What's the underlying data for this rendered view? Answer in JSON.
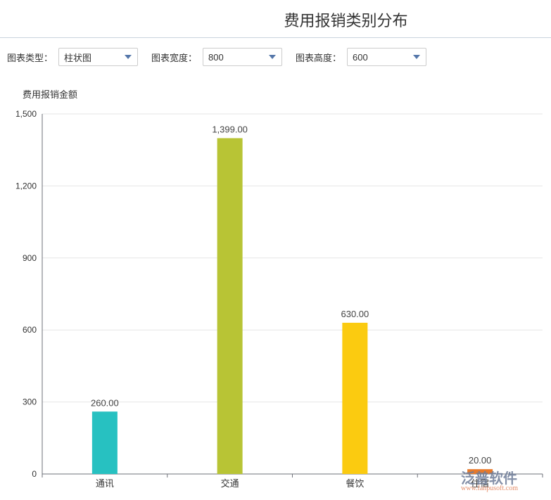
{
  "title": "费用报销类别分布",
  "controls": [
    {
      "label": "图表类型：",
      "value": "柱状图"
    },
    {
      "label": "图表宽度：",
      "value": "800"
    },
    {
      "label": "图表高度：",
      "value": "600"
    }
  ],
  "watermark": {
    "name": "泛普软件",
    "url": "www.fanpusoft.com"
  },
  "chart_data": {
    "type": "bar",
    "title": "费用报销类别分布",
    "ylabel": "费用报销金额",
    "xlabel": "",
    "categories": [
      "通讯",
      "交通",
      "餐饮",
      "住宿"
    ],
    "values": [
      260,
      1399,
      630,
      20
    ],
    "data_labels": [
      "260.00",
      "1,399.00",
      "630.00",
      "20.00"
    ],
    "colors": [
      "#27c1c1",
      "#b8c435",
      "#fbcb10",
      "#e8792a"
    ],
    "ylim": [
      0,
      1500
    ],
    "yticks": [
      0,
      300,
      600,
      900,
      1200,
      1500
    ],
    "ytick_labels": [
      "0",
      "300",
      "600",
      "900",
      "1,200",
      "1,500"
    ],
    "grid": true
  }
}
